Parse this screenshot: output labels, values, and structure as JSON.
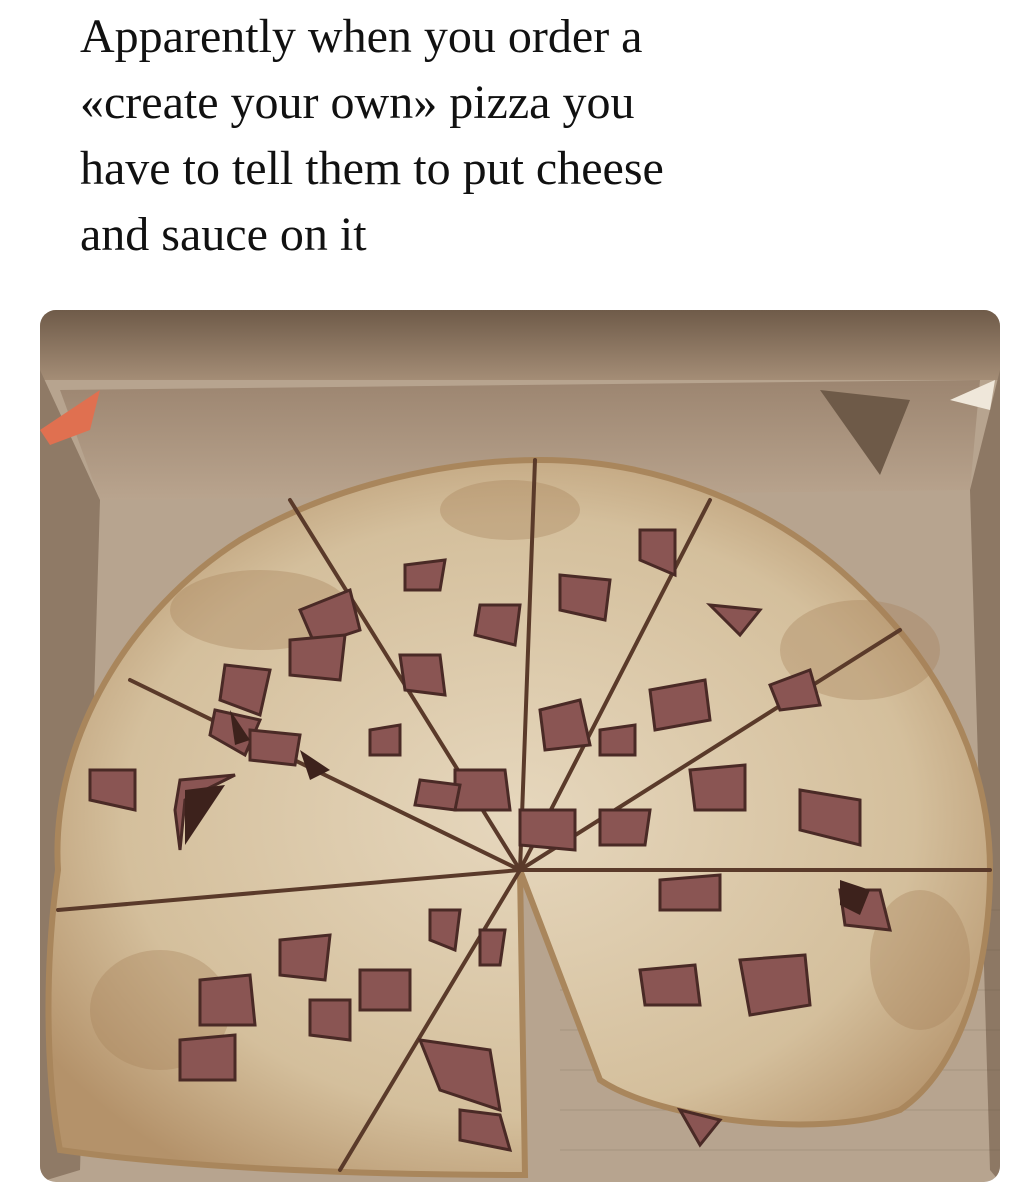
{
  "caption": {
    "lines": [
      "Apparently when you order a",
      "«create your own» pizza you",
      "have to tell them to put cheese",
      "and sauce on it"
    ]
  },
  "photo": {
    "subject": "pizza-box-with-plain-crust-and-ham",
    "colors": {
      "box_cardboard": "#b9a48e",
      "box_shadow": "#8b7560",
      "crust": "#d8c5a6",
      "crust_edge": "#b18e63",
      "ham": "#8a5553",
      "ham_dark": "#4a2a26",
      "cut_line": "#5a3a2a"
    }
  }
}
